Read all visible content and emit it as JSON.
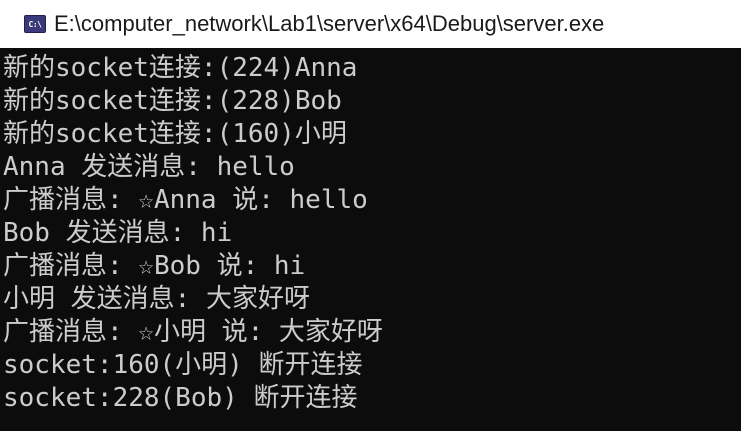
{
  "window": {
    "title": "E:\\computer_network\\Lab1\\server\\x64\\Debug\\server.exe",
    "icon_name": "console-app-icon",
    "icon_text": "C:\\"
  },
  "console": {
    "lines": [
      "新的socket连接:(224)Anna",
      "新的socket连接:(228)Bob",
      "新的socket连接:(160)小明",
      "Anna 发送消息: hello",
      "广播消息: ☆Anna 说: hello",
      "Bob 发送消息: hi",
      "广播消息: ☆Bob 说: hi",
      "小明 发送消息: 大家好呀",
      "广播消息: ☆小明 说: 大家好呀",
      "socket:160(小明) 断开连接",
      "socket:228(Bob) 断开连接"
    ]
  },
  "colors": {
    "background": "#0c0c0c",
    "text": "#cccccc",
    "titlebar": "#ffffff"
  }
}
